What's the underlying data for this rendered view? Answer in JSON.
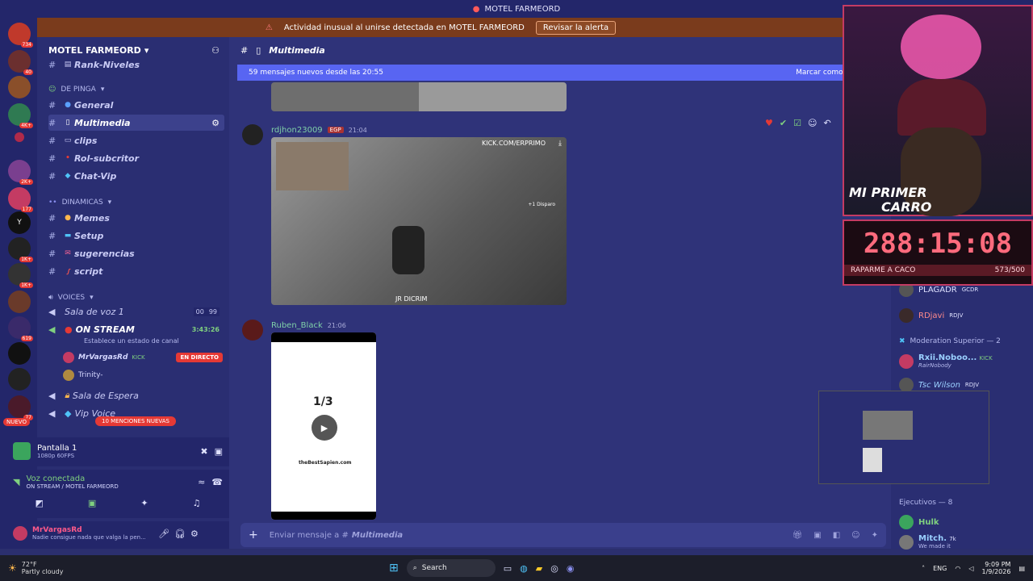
{
  "window": {
    "title": "MOTEL FARMEORD"
  },
  "alert": {
    "text": "Actividad inusual al unirse detectada en MOTEL FARMEORD",
    "button": "Revisar la alerta"
  },
  "servers": [
    {
      "badge": "734"
    },
    {
      "badge": "40"
    },
    {
      "badge": ""
    },
    {
      "badge": "4K+"
    },
    {
      "badge": ""
    },
    {
      "badge": "2K+"
    },
    {
      "badge": "177"
    },
    {
      "badge": ""
    },
    {
      "badge": "1K+"
    },
    {
      "badge": "1K+"
    },
    {
      "badge": ""
    },
    {
      "badge": "619"
    },
    {
      "badge": ""
    },
    {
      "badge": ""
    },
    {
      "badge": "77"
    }
  ],
  "sidebar": {
    "server_name": "MOTEL FARMEORD",
    "top_channel": "Rank-Niveles",
    "categories": {
      "pinga": "DE PINGA",
      "dinamicas": "DINAMICAS",
      "voices": "VOICES"
    },
    "channels_pinga": [
      {
        "name": "General"
      },
      {
        "name": "Multimedia"
      },
      {
        "name": "clips"
      },
      {
        "name": "Rol-subcritor"
      },
      {
        "name": "Chat-Vip"
      }
    ],
    "channels_dinamicas": [
      {
        "name": "Memes"
      },
      {
        "name": "Setup"
      },
      {
        "name": "sugerencias"
      },
      {
        "name": "script"
      }
    ],
    "voice1": {
      "name": "Sala de voz 1",
      "c1": "00",
      "c2": "99"
    },
    "onstream": {
      "name": "ON STREAM",
      "time": "3:43:26",
      "status": "Establece un estado de canal"
    },
    "members": [
      {
        "name": "MrVargasRd",
        "tag": "KICK",
        "live": "EN DIRECTO"
      },
      {
        "name": "Trinity-"
      }
    ],
    "voice2": {
      "name": "Sala de Espera"
    },
    "voice3": {
      "name": "Vip Voice"
    },
    "nuevo": "NUEVO",
    "mentions": "10 MENCIONES NUEVAS",
    "screen": {
      "title": "Pantalla 1",
      "sub": "1080p 60FPS"
    },
    "voice_conn": {
      "title": "Voz conectada",
      "sub": "ON STREAM / MOTEL FARMEORD"
    },
    "user": {
      "name": "MrVargasRd",
      "status": "Nadie consigue nada que valga la pen..."
    }
  },
  "main": {
    "channel": "Multimedia",
    "new_messages": "59 mensajes nuevos desde las 20:55",
    "mark_read": "Marcar como l",
    "messages": [
      {
        "user": "rdjhon23009",
        "tag": "EGP",
        "time": "21:04",
        "overlay_top": "KICK.COM/ERPRIMO",
        "overlay_bottom": "JR DICRIM",
        "overlay_side": "+1 Disparo"
      },
      {
        "user": "Ruben_Black",
        "time": "21:06",
        "counter": "1/3",
        "site": "theBestSapien.com"
      }
    ],
    "input_placeholder": "Enviar mensaje a #",
    "input_channel": "Multimedia"
  },
  "stream": {
    "banner1": "MI PRIMER",
    "banner2": "CARRO",
    "timer": "288:15:08",
    "footer_left": "RAPARME A CACO",
    "footer_right": "573/500"
  },
  "right": {
    "m0": {
      "name": "PLAGADR",
      "tag": "GCDR"
    },
    "m1": {
      "name": "RDjavi",
      "tag": "RDJV"
    },
    "section1": "Moderation Superior — 2",
    "m2": {
      "name": "Rxii.Noboo...",
      "tag": "KICK",
      "sub": "RairNobody"
    },
    "m3": {
      "name": "Tsc Wilson",
      "tag": "RDJV"
    },
    "section2": "Ejecutivos — 8",
    "m4": {
      "name": "Hulk"
    },
    "m5": {
      "name": "Mitch.",
      "tag": "7k",
      "sub": "We made it"
    }
  },
  "taskbar": {
    "temp": "72°F",
    "weather": "Partly cloudy",
    "search": "Search",
    "lang": "ENG",
    "time": "9:09 PM",
    "date": "1/9/2026"
  }
}
